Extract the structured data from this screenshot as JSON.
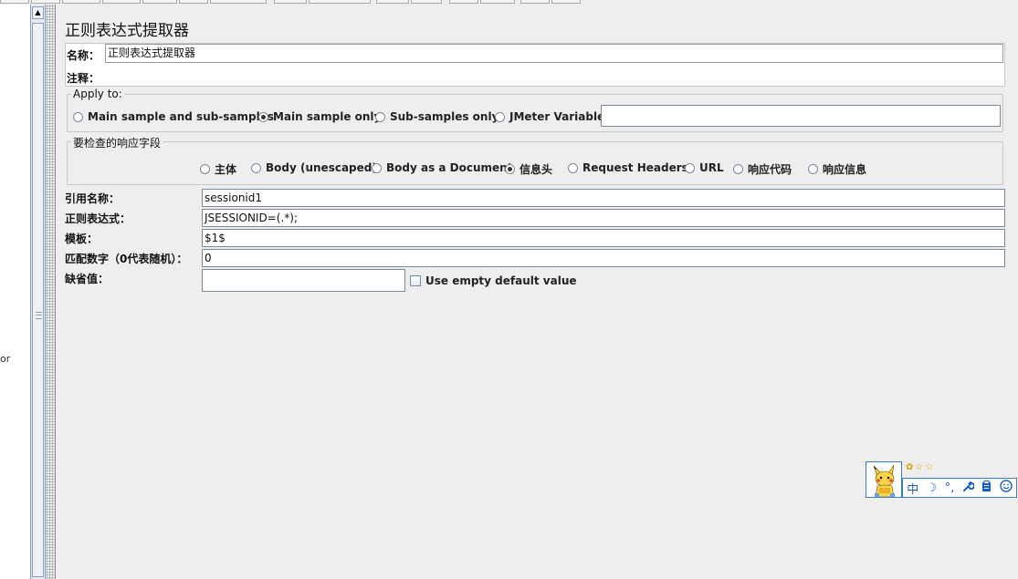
{
  "tree": {
    "partial_text": "or"
  },
  "panel": {
    "title": "正则表达式提取器",
    "name_label": "名称：",
    "name_value": "正则表达式提取器",
    "comment_label": "注释：",
    "comment_value": ""
  },
  "apply_to": {
    "legend": "Apply to:",
    "options": [
      {
        "label": "Main sample and sub-samples",
        "selected": false
      },
      {
        "label": "Main sample only",
        "selected": true
      },
      {
        "label": "Sub-samples only",
        "selected": false
      },
      {
        "label": "JMeter Variable",
        "selected": false
      }
    ],
    "variable_value": ""
  },
  "field_to_check": {
    "legend": "要检查的响应字段",
    "options": [
      {
        "label": "主体",
        "selected": false
      },
      {
        "label": "Body (unescaped)",
        "selected": false
      },
      {
        "label": "Body as a Document",
        "selected": false
      },
      {
        "label": "信息头",
        "selected": true
      },
      {
        "label": "Request Headers",
        "selected": false
      },
      {
        "label": "URL",
        "selected": false
      },
      {
        "label": "响应代码",
        "selected": false
      },
      {
        "label": "响应信息",
        "selected": false
      }
    ]
  },
  "params": {
    "ref_name_label": "引用名称：",
    "ref_name_value": "sessionid1",
    "regex_label": "正则表达式：",
    "regex_value": "JSESSIONID=(.*);",
    "template_label": "模板：",
    "template_value": "$1$",
    "match_no_label": "匹配数字（0代表随机）：",
    "match_no_value": "0",
    "default_label": "缺省值：",
    "default_value": "",
    "use_empty_label": "Use empty default value"
  },
  "ime": {
    "stars": "✿☆☆",
    "chinese_mode": "中",
    "moon": "☽",
    "punct": "°,",
    "wrench": "🔧",
    "clipboard": "📋",
    "smile": "☺"
  }
}
